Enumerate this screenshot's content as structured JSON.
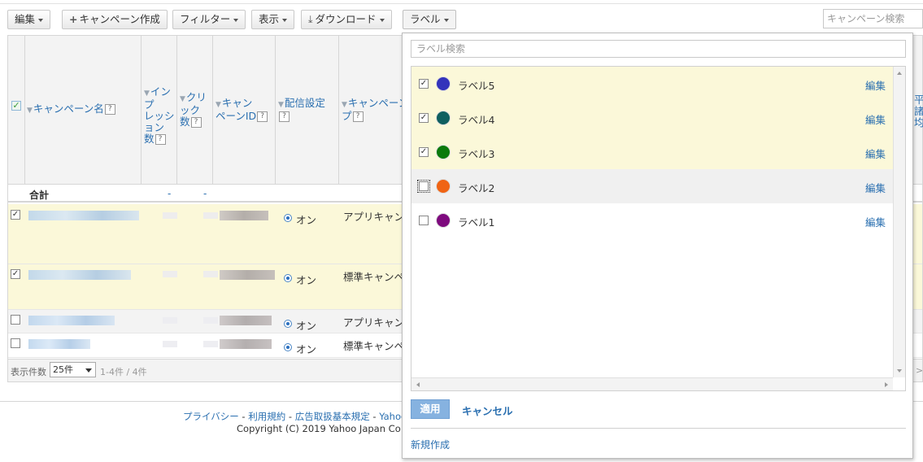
{
  "toolbar": {
    "edit": "編集",
    "create_campaign": "キャンペーン作成",
    "filter": "フィルター",
    "display": "表示",
    "download": "ダウンロード",
    "label": "ラベル",
    "search_placeholder": "キャンペーン検索"
  },
  "table": {
    "headers": {
      "campaign_name": "キャンペーン名",
      "impressions": [
        "インプ",
        "レッシ",
        "ョン",
        "数"
      ],
      "clicks": [
        "クリ",
        "ック",
        "数"
      ],
      "campaign_id": [
        "キャン",
        "ペーンID"
      ],
      "delivery": "配信設定",
      "campaign_type": [
        "キャンペーン",
        "プ"
      ]
    },
    "total": {
      "label": "合計",
      "impressions": "-",
      "clicks": "-"
    },
    "rows": [
      {
        "checked": true,
        "delivery": "オン",
        "type": "アプリキャン"
      },
      {
        "checked": true,
        "delivery": "オン",
        "type": "標準キャンペ"
      },
      {
        "checked": false,
        "delivery": "オン",
        "type": "アプリキャン"
      },
      {
        "checked": false,
        "delivery": "オン",
        "type": "標準キャンペ"
      }
    ],
    "pager": {
      "label": "表示件数",
      "per_page": "25件",
      "count": "1-4件 / 4件"
    },
    "right_cut": {
      "col_hdr1": "平",
      "col_hdr2": "諸",
      "col_hdr3": "均",
      "pager_arrow": ">>"
    }
  },
  "footer": {
    "privacy": "プライバシー",
    "terms": "利用規約",
    "ad_terms": "広告取扱基本規定",
    "yahoo": "Yahoo",
    "sep": " - ",
    "copyright": "Copyright (C) 2019 Yahoo Japan Co"
  },
  "label_panel": {
    "search_placeholder": "ラベル検索",
    "items": [
      {
        "name": "ラベル5",
        "color": "#3333bb",
        "checked": true,
        "edit": "編集"
      },
      {
        "name": "ラベル4",
        "color": "#0f5f5f",
        "checked": true,
        "edit": "編集"
      },
      {
        "name": "ラベル3",
        "color": "#0b7a0b",
        "checked": true,
        "edit": "編集"
      },
      {
        "name": "ラベル2",
        "color": "#f06414",
        "checked": false,
        "edit": "編集"
      },
      {
        "name": "ラベル1",
        "color": "#7e0a7e",
        "checked": false,
        "edit": "編集"
      }
    ],
    "apply": "適用",
    "cancel": "キャンセル",
    "new_label": "新規作成"
  }
}
